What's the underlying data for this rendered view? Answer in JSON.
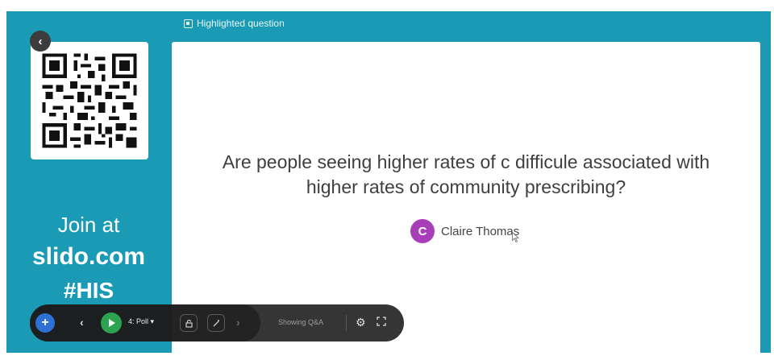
{
  "header": {
    "highlight_label": "Highlighted question",
    "highlight_icon": "highlight-icon"
  },
  "join": {
    "line1": "Join at",
    "url": "slido.com",
    "code": "#HIS"
  },
  "question": {
    "text": "Are people seeing higher rates of c difficule associated with higher rates of community prescribing?",
    "author_initial": "C",
    "author_name": "Claire Thomas"
  },
  "toolbar": {
    "add_label": "+",
    "prev_label": "‹",
    "next_label": "›",
    "poll_label": "4: Poll ▾",
    "status_label": "Showing Q&A",
    "settings_glyph": "⚙",
    "icons": [
      "add-icon",
      "chevron-left-icon",
      "play-icon",
      "lock-icon",
      "magic-icon",
      "chevron-right-icon",
      "gear-icon",
      "fullscreen-icon"
    ]
  },
  "back_label": "‹",
  "colors": {
    "stage": "#1a9ab4",
    "avatar": "#a93fb8",
    "play": "#2da44e",
    "add": "#2f6fd6"
  }
}
